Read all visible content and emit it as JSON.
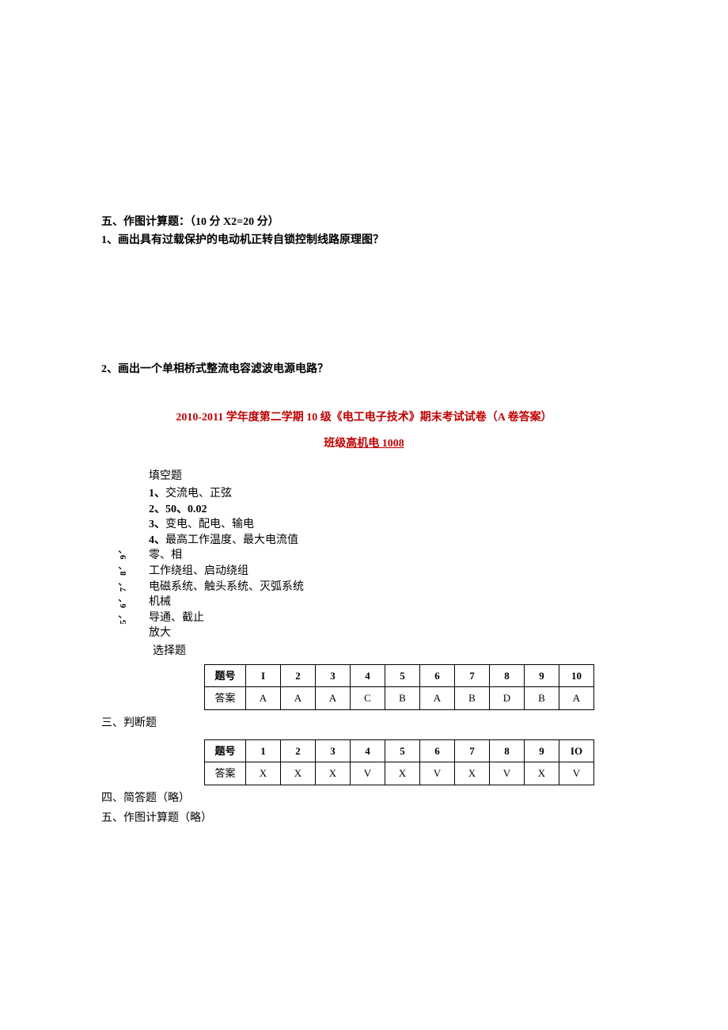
{
  "section5": {
    "title": "五、作图计算题：（10 分 X2=20 分）",
    "q1": "1、画出具有过载保护的电动机正转自锁控制线路原理图？",
    "q2": "2、画出一个单相桥式整流电容滤波电源电路？"
  },
  "answer": {
    "title": "2010-2011 学年度第二学期 10 级《电工电子技术》期末考试试卷（A 卷答案）",
    "subtitle_prefix": "班级",
    "subtitle_underline": "高机电 1008"
  },
  "fill": {
    "header": "填空题",
    "sidebar": "5、6、7、8、9、",
    "items": [
      {
        "num": "1、",
        "content": "交流电、正弦"
      },
      {
        "num": "2、",
        "content": "50、0.02",
        "bold": true
      },
      {
        "num": "3、",
        "content": "变电、配电、输电"
      },
      {
        "num": "4、",
        "content": "最高工作温度、最大电流值"
      },
      {
        "num": "",
        "content": "零、相"
      },
      {
        "num": "",
        "content": "工作绕组、启动绕组"
      },
      {
        "num": "",
        "content": "电磁系统、触头系统、灭弧系统"
      },
      {
        "num": "",
        "content": "机械"
      },
      {
        "num": "",
        "content": "导通、截止"
      },
      {
        "num": "",
        "content": "放大"
      }
    ]
  },
  "choice": {
    "header": "选择题",
    "row_label": "题号",
    "ans_label": "答案",
    "nums": [
      "I",
      "2",
      "3",
      "4",
      "5",
      "6",
      "7",
      "8",
      "9",
      "10"
    ],
    "answers": [
      "A",
      "A",
      "A",
      "C",
      "B",
      "A",
      "B",
      "D",
      "B",
      "A"
    ]
  },
  "judge": {
    "header": "三、判断题",
    "row_label": "题号",
    "ans_label": "答案",
    "nums": [
      "1",
      "2",
      "3",
      "4",
      "5",
      "6",
      "7",
      "8",
      "9",
      "IO"
    ],
    "answers": [
      "X",
      "X",
      "X",
      "V",
      "X",
      "V",
      "X",
      "V",
      "X",
      "V"
    ]
  },
  "final": {
    "note1": "四、简答题（略）",
    "note2": "五、作图计算题（略）"
  }
}
